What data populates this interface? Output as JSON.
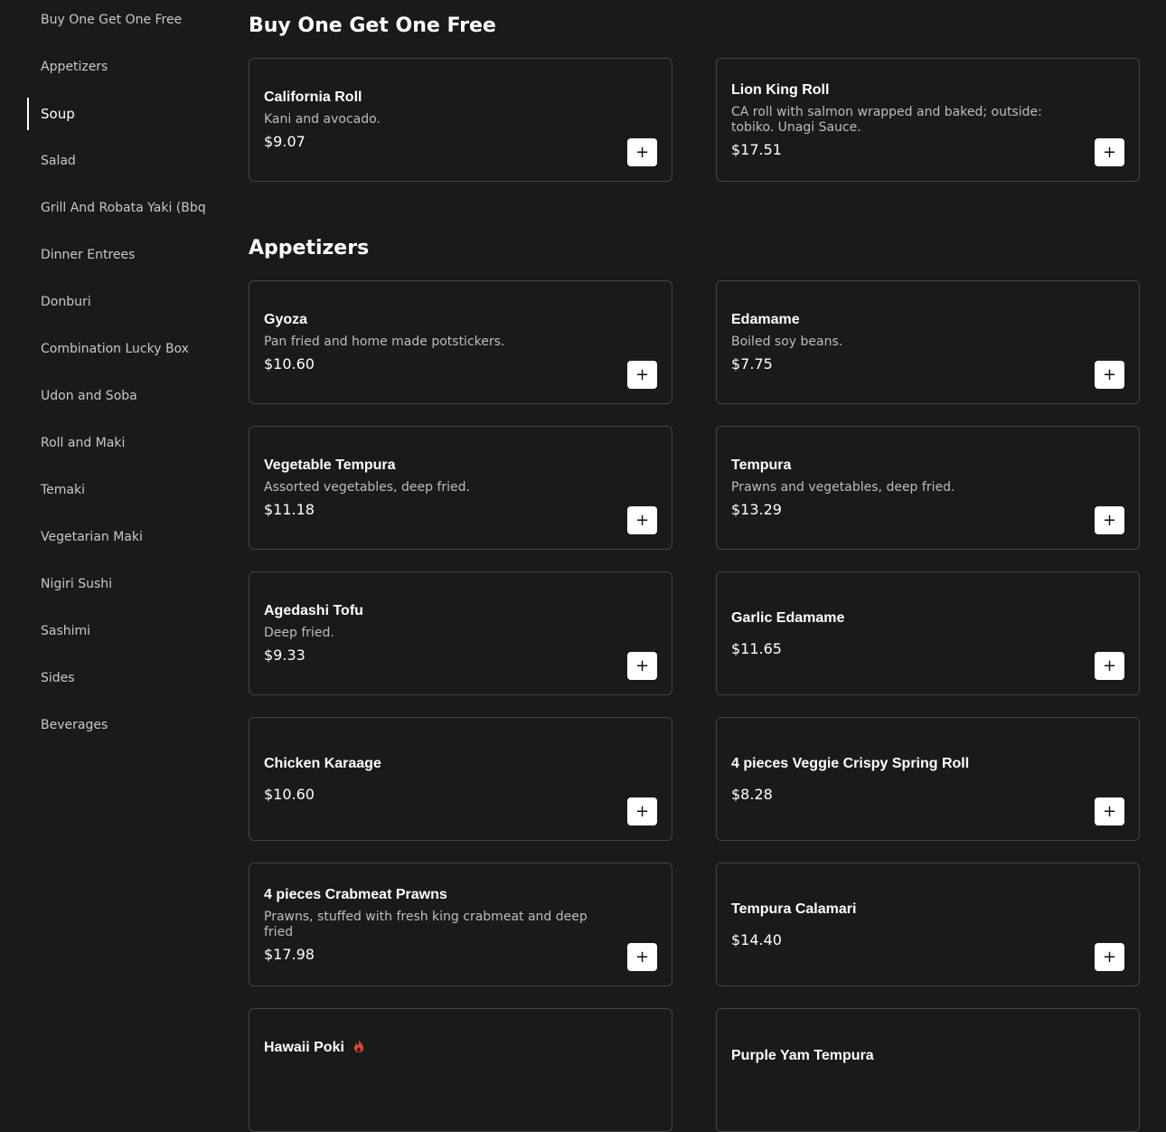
{
  "sidebar": {
    "items": [
      {
        "label": "Buy One Get One Free"
      },
      {
        "label": "Appetizers"
      },
      {
        "label": "Soup"
      },
      {
        "label": "Salad"
      },
      {
        "label": "Grill And Robata Yaki (Bbq"
      },
      {
        "label": "Dinner Entrees"
      },
      {
        "label": "Donburi"
      },
      {
        "label": "Combination Lucky Box"
      },
      {
        "label": "Udon and Soba"
      },
      {
        "label": "Roll and Maki"
      },
      {
        "label": "Temaki"
      },
      {
        "label": "Vegetarian Maki"
      },
      {
        "label": "Nigiri Sushi"
      },
      {
        "label": "Sashimi"
      },
      {
        "label": "Sides"
      },
      {
        "label": "Beverages"
      }
    ],
    "active_label": "Soup"
  },
  "sections": [
    {
      "title": "Buy One Get One Free",
      "items": [
        {
          "name": "California Roll",
          "description": "Kani and avocado.",
          "price": "$9.07"
        },
        {
          "name": "Lion King Roll",
          "description": "CA roll with salmon wrapped and baked; outside: tobiko. Unagi Sauce.",
          "price": "$17.51"
        }
      ]
    },
    {
      "title": "Appetizers",
      "items": [
        {
          "name": "Gyoza",
          "description": "Pan fried and home made potstickers.",
          "price": "$10.60"
        },
        {
          "name": "Edamame",
          "description": "Boiled soy beans.",
          "price": "$7.75"
        },
        {
          "name": "Vegetable Tempura",
          "description": "Assorted vegetables, deep fried.",
          "price": "$11.18"
        },
        {
          "name": "Tempura",
          "description": "Prawns and vegetables, deep fried.",
          "price": "$13.29"
        },
        {
          "name": "Agedashi Tofu",
          "description": "Deep fried.",
          "price": "$9.33"
        },
        {
          "name": "Garlic Edamame",
          "description": "",
          "price": "$11.65"
        },
        {
          "name": "Chicken Karaage",
          "description": "",
          "price": "$10.60"
        },
        {
          "name": "4 pieces Veggie Crispy Spring Roll",
          "description": "",
          "price": "$8.28"
        },
        {
          "name": "4 pieces Crabmeat Prawns",
          "description": "Prawns, stuffed with fresh king crabmeat and deep fried",
          "price": "$17.98"
        },
        {
          "name": "Tempura Calamari",
          "description": "",
          "price": "$14.40"
        },
        {
          "name": "Hawaii Poki",
          "description": "",
          "price": "",
          "spicy_icon": "flame-icon"
        },
        {
          "name": "Purple Yam Tempura",
          "description": "",
          "price": ""
        }
      ]
    }
  ],
  "add_button_label": "+",
  "colors": {
    "background": "#1a1a1a",
    "card_border": "#444444",
    "spicy": "#e0463a"
  }
}
